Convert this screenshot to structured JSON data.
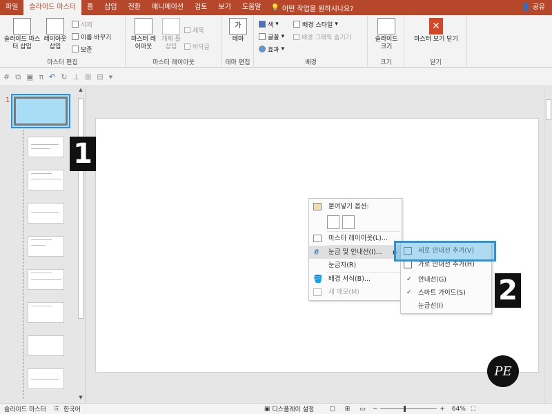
{
  "tabs": [
    "파일",
    "슬라이드 마스터",
    "홈",
    "삽입",
    "전환",
    "애니메이션",
    "검토",
    "보기",
    "도움말"
  ],
  "tell_me": "어떤 작업을 원하시나요?",
  "share": "공유",
  "ribbon": {
    "master_edit": {
      "label": "마스터 편집",
      "insert_master": "슬라이드 마스터 삽입",
      "insert_layout": "레이아웃 삽입",
      "delete": "삭제",
      "rename": "이름 바꾸기",
      "preserve": "보존"
    },
    "master_layout": {
      "label": "마스터 레이아웃",
      "master_layout_btn": "마스터 레이아웃",
      "insert_placeholder": "개체 틀 삽입",
      "title": "제목",
      "footer": "바닥글"
    },
    "theme_edit": {
      "label": "테마 편집",
      "theme": "테마"
    },
    "background": {
      "label": "배경",
      "colors": "색",
      "fonts": "글꼴",
      "effects": "효과",
      "bg_styles": "배경 스타일",
      "hide_bg": "배경 그래픽 숨기기"
    },
    "size": {
      "label": "크기",
      "slide_size": "슬라이드 크기"
    },
    "close": {
      "label": "닫기",
      "close_master": "마스터 보기 닫기"
    }
  },
  "thumbs": {
    "slide_number": "1"
  },
  "context_menu": {
    "paste_options": "붙여넣기 옵션:",
    "master_layout": "마스터 레이아웃(L)...",
    "grid_guides": "눈금 및 안내선(I)...",
    "ruler": "눈금자(R)",
    "format_bg": "배경 서식(B)...",
    "new_comment": "새 메모(M)"
  },
  "submenu": {
    "add_vertical": "세로 안내선 추가(V)",
    "add_horizontal": "가로 안내선 추가(H)",
    "guides": "안내선(G)",
    "smart_guides": "스마트 가이드(S)",
    "gridlines": "눈금선(I)"
  },
  "badges": {
    "one": "1",
    "two": "2"
  },
  "status": {
    "view_name": "슬라이드 마스터",
    "language": "한국어",
    "display_settings": "디스플레이 설정",
    "zoom": "64%"
  },
  "colors": {
    "accent": "#b7472a",
    "highlight": "#2b93d8"
  }
}
